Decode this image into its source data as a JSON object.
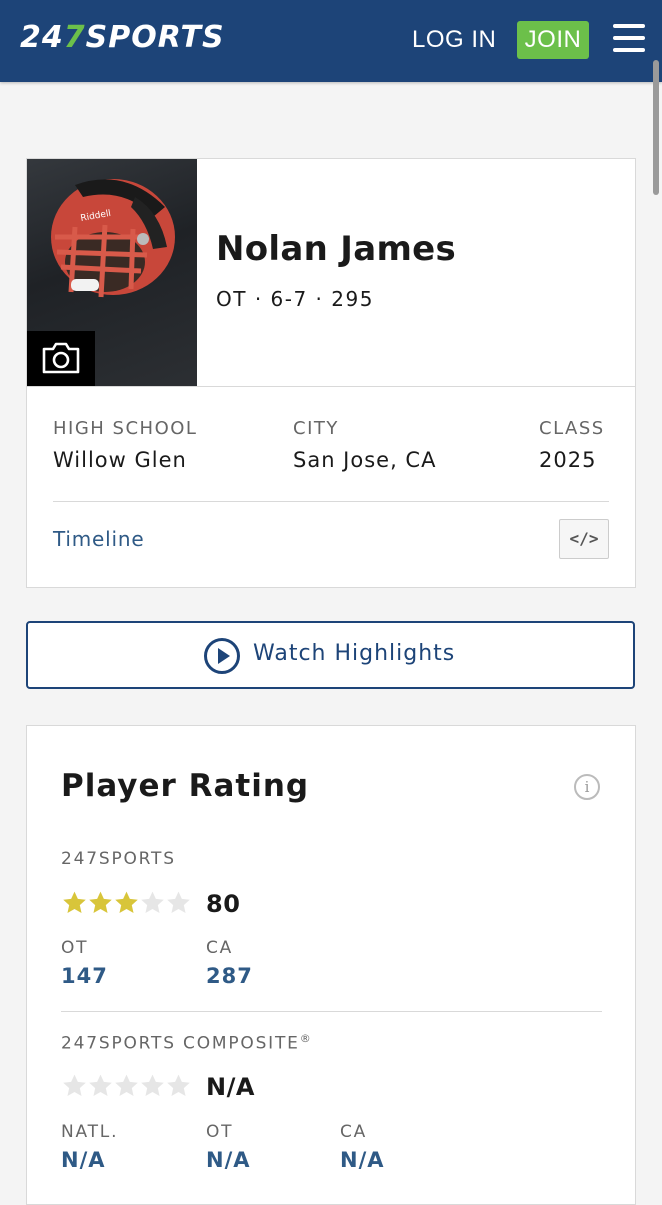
{
  "header": {
    "logo_prefix": "24",
    "logo_seven": "7",
    "logo_suffix": "SPORTS",
    "login_label": "LOG IN",
    "join_label": "JOIN",
    "colors": {
      "background": "#1d4478",
      "join": "#6cc04a"
    }
  },
  "player": {
    "name": "Nolan James",
    "position_meta": "OT · 6-7 · 295",
    "photo_icon": "camera-icon",
    "info": [
      {
        "label": "HIGH SCHOOL",
        "value": "Willow Glen"
      },
      {
        "label": "CITY",
        "value": "San Jose, CA"
      },
      {
        "label": "CLASS",
        "value": "2025"
      }
    ],
    "timeline_label": "Timeline",
    "embed_label": "</>"
  },
  "highlights": {
    "label": "Watch Highlights",
    "icon": "play-circle-icon"
  },
  "rating": {
    "title": "Player Rating",
    "info_icon_label": "i",
    "sports247": {
      "label": "247SPORTS",
      "stars_filled": 3,
      "stars_total": 5,
      "score": "80",
      "ranks": [
        {
          "label": "OT",
          "value": "147"
        },
        {
          "label": "CA",
          "value": "287"
        }
      ]
    },
    "composite": {
      "label": "247SPORTS COMPOSITE",
      "registered_mark": "®",
      "stars_filled": 0,
      "stars_total": 5,
      "score": "N/A",
      "ranks": [
        {
          "label": "NATL.",
          "value": "N/A"
        },
        {
          "label": "OT",
          "value": "N/A"
        },
        {
          "label": "CA",
          "value": "N/A"
        }
      ]
    },
    "colors": {
      "star_filled": "#d8c53a",
      "star_empty": "#e6e6e6",
      "rank_value": "#2f5a86"
    }
  }
}
